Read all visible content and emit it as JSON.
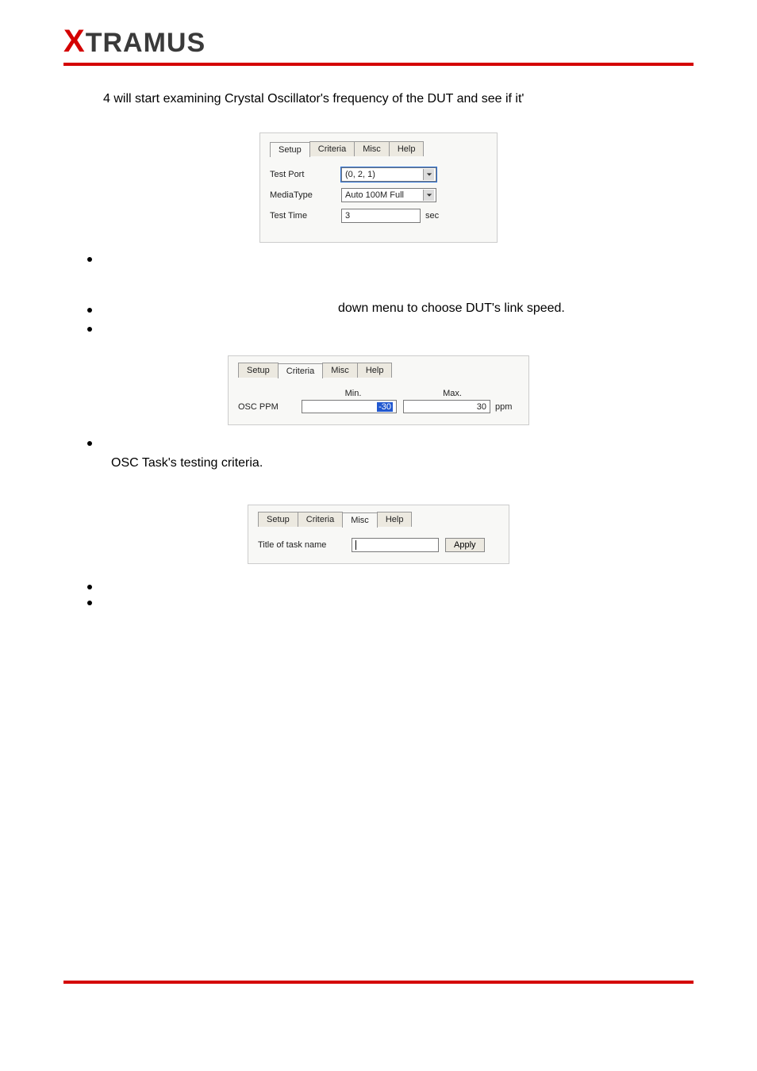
{
  "logo": {
    "x": "X",
    "rest": "TRAMUS"
  },
  "intro_text": "4 will start examining Crystal Oscillator's frequency of the DUT and see if it'",
  "setup_panel": {
    "tabs": [
      "Setup",
      "Criteria",
      "Misc",
      "Help"
    ],
    "active_tab": "Setup",
    "rows": {
      "test_port": {
        "label": "Test Port",
        "value": "(0, 2, 1)"
      },
      "media_type": {
        "label": "MediaType",
        "value": "Auto 100M Full"
      },
      "test_time": {
        "label": "Test Time",
        "value": "3",
        "unit": "sec"
      }
    }
  },
  "bullets_after_setup": [
    "",
    "down menu to choose DUT's link speed.",
    ""
  ],
  "criteria_panel": {
    "tabs": [
      "Setup",
      "Criteria",
      "Misc",
      "Help"
    ],
    "active_tab": "Criteria",
    "columns": {
      "min": "Min.",
      "max": "Max."
    },
    "row": {
      "label": "OSC PPM",
      "min": "-30",
      "max": "30",
      "unit": "ppm"
    }
  },
  "criteria_bullet": "",
  "criteria_text": "OSC Task's testing criteria.",
  "misc_panel": {
    "tabs": [
      "Setup",
      "Criteria",
      "Misc",
      "Help"
    ],
    "active_tab": "Misc",
    "title_label": "Title of task name",
    "title_value": "",
    "apply_label": "Apply"
  },
  "bullets_after_misc": [
    "",
    ""
  ]
}
